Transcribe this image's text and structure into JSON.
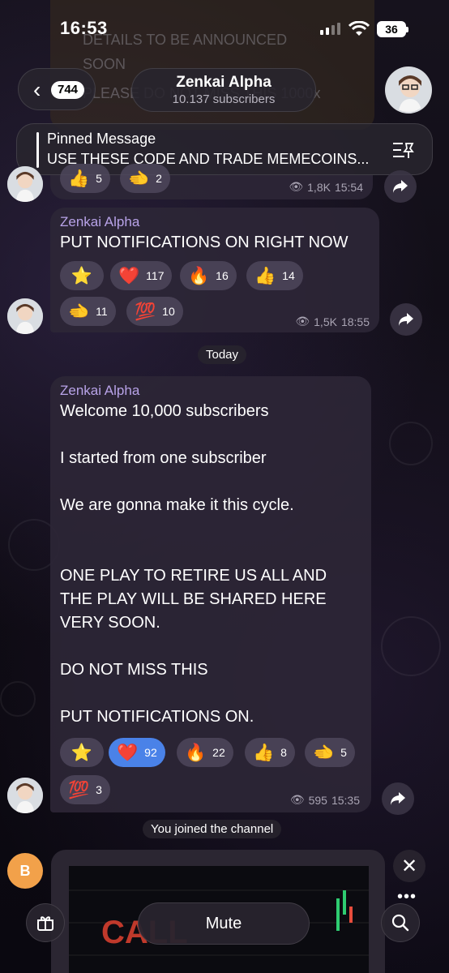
{
  "status_bar": {
    "time": "16:53",
    "battery": "36"
  },
  "background_post": {
    "lines": [
      "DETAILS TO BE ANNOUNCED",
      "SOON",
      "PLEASE DO NOT MISS THIS 1000x"
    ]
  },
  "header": {
    "back_count": "744",
    "channel_name": "Zenkai Alpha",
    "subscribers": "10.137 subscribers"
  },
  "pinned": {
    "title": "Pinned Message",
    "text": "USE THESE CODE AND TRADE MEMECOINS..."
  },
  "message_top": {
    "reactions": [
      {
        "emoji": "👍",
        "count": "5"
      },
      {
        "emoji": "🫲",
        "count": "2"
      }
    ],
    "views": "1,8K",
    "time": "15:54"
  },
  "message_1": {
    "sender": "Zenkai Alpha",
    "text": "PUT NOTIFICATIONS ON RIGHT NOW",
    "reactions": [
      {
        "emoji": "⭐",
        "count": ""
      },
      {
        "emoji": "❤️",
        "count": "117"
      },
      {
        "emoji": "🔥",
        "count": "16"
      },
      {
        "emoji": "👍",
        "count": "14"
      },
      {
        "emoji": "🫲",
        "count": "11"
      },
      {
        "emoji": "💯",
        "count": "10"
      }
    ],
    "views": "1,5K",
    "time": "18:55"
  },
  "date_separator": "Today",
  "message_2": {
    "sender": "Zenkai Alpha",
    "lines": [
      "Welcome 10,000 subscribers",
      "",
      "I started from one subscriber",
      "",
      "We are gonna make it this cycle.",
      "",
      "",
      "ONE PLAY TO RETIRE US ALL AND",
      "THE PLAY WILL BE SHARED HERE",
      "VERY SOON.",
      "",
      "DO NOT MISS THIS",
      "",
      "PUT NOTIFICATIONS ON."
    ],
    "reactions": [
      {
        "emoji": "⭐",
        "count": ""
      },
      {
        "emoji": "❤️",
        "count": "92",
        "selected": true
      },
      {
        "emoji": "🔥",
        "count": "22"
      },
      {
        "emoji": "👍",
        "count": "8"
      },
      {
        "emoji": "🫲",
        "count": "5"
      },
      {
        "emoji": "💯",
        "count": "3"
      }
    ],
    "views": "595",
    "time": "15:35"
  },
  "service_message": "You joined the channel",
  "bottom": {
    "mute_label": "Mute",
    "avatar_letter": "B",
    "preview_text": "CALL"
  },
  "colors": {
    "accent": "#4a82e8",
    "sender": "#b8a3e8",
    "bubble": "#2c2636"
  }
}
